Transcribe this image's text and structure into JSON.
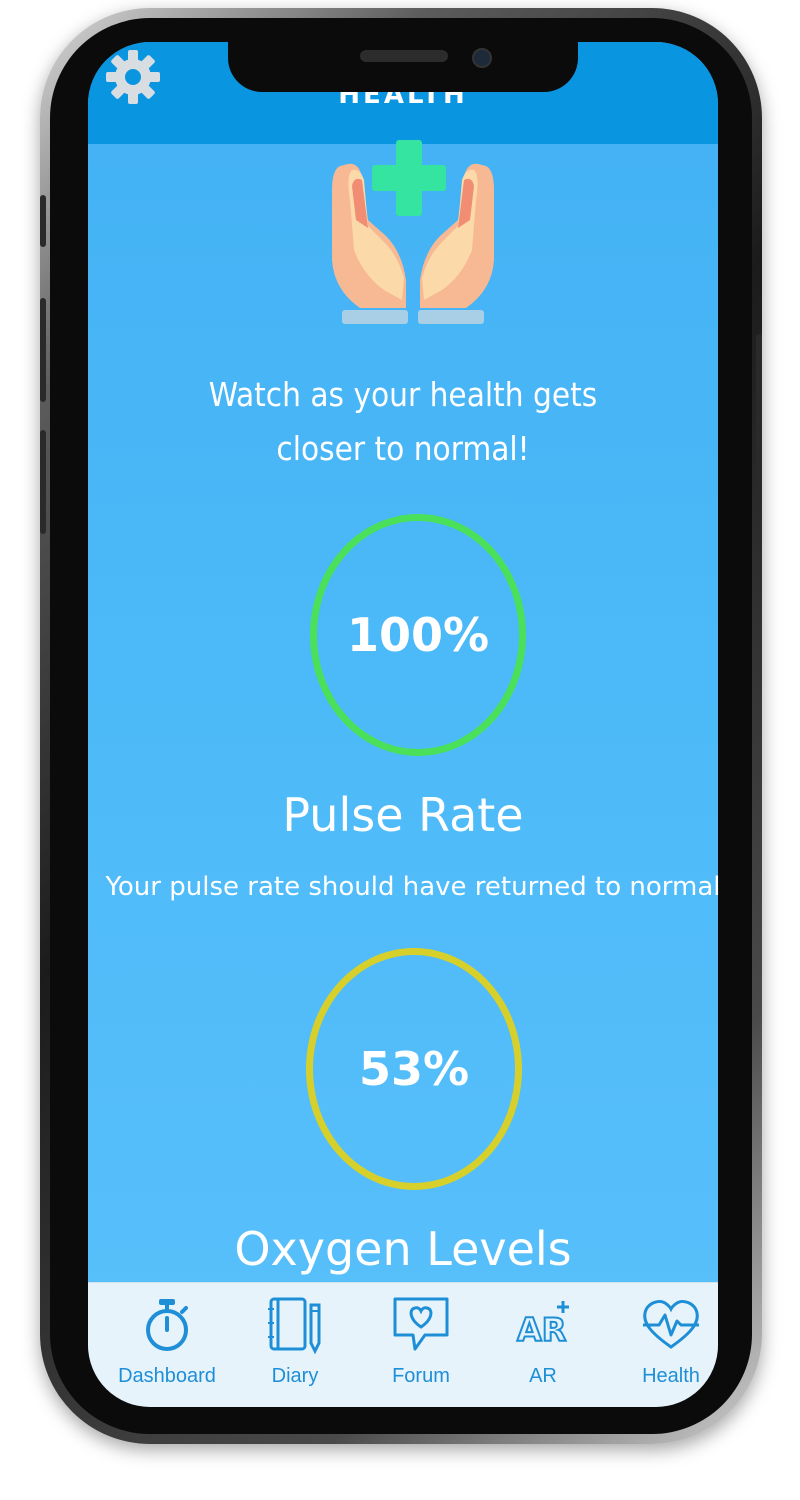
{
  "header": {
    "title": "HEALTH",
    "settings_icon": "gear-icon"
  },
  "hero": {
    "icon": "hands-medical-cross-icon",
    "tagline_line1": "Watch as your health gets",
    "tagline_line2": "closer to normal!"
  },
  "pulse": {
    "value": "100%",
    "progress": 1.0,
    "color": "#4be05a",
    "title": "Pulse Rate",
    "subtitle": "Your pulse rate should have returned to normal"
  },
  "oxygen": {
    "value": "53%",
    "progress": 0.53,
    "color": "#d7d02a",
    "title": "Oxygen Levels"
  },
  "tabs": [
    {
      "label": "Dashboard",
      "icon": "stopwatch-icon"
    },
    {
      "label": "Diary",
      "icon": "notebook-pencil-icon"
    },
    {
      "label": "Forum",
      "icon": "chat-heart-icon"
    },
    {
      "label": "AR",
      "icon": "ar-plus-icon"
    },
    {
      "label": "Health",
      "icon": "heart-pulse-icon"
    }
  ],
  "colors": {
    "header": "#0a95e0",
    "background": "#4db8f7",
    "tab_text": "#1e8fd6",
    "tabbar": "#e6f3fb"
  }
}
